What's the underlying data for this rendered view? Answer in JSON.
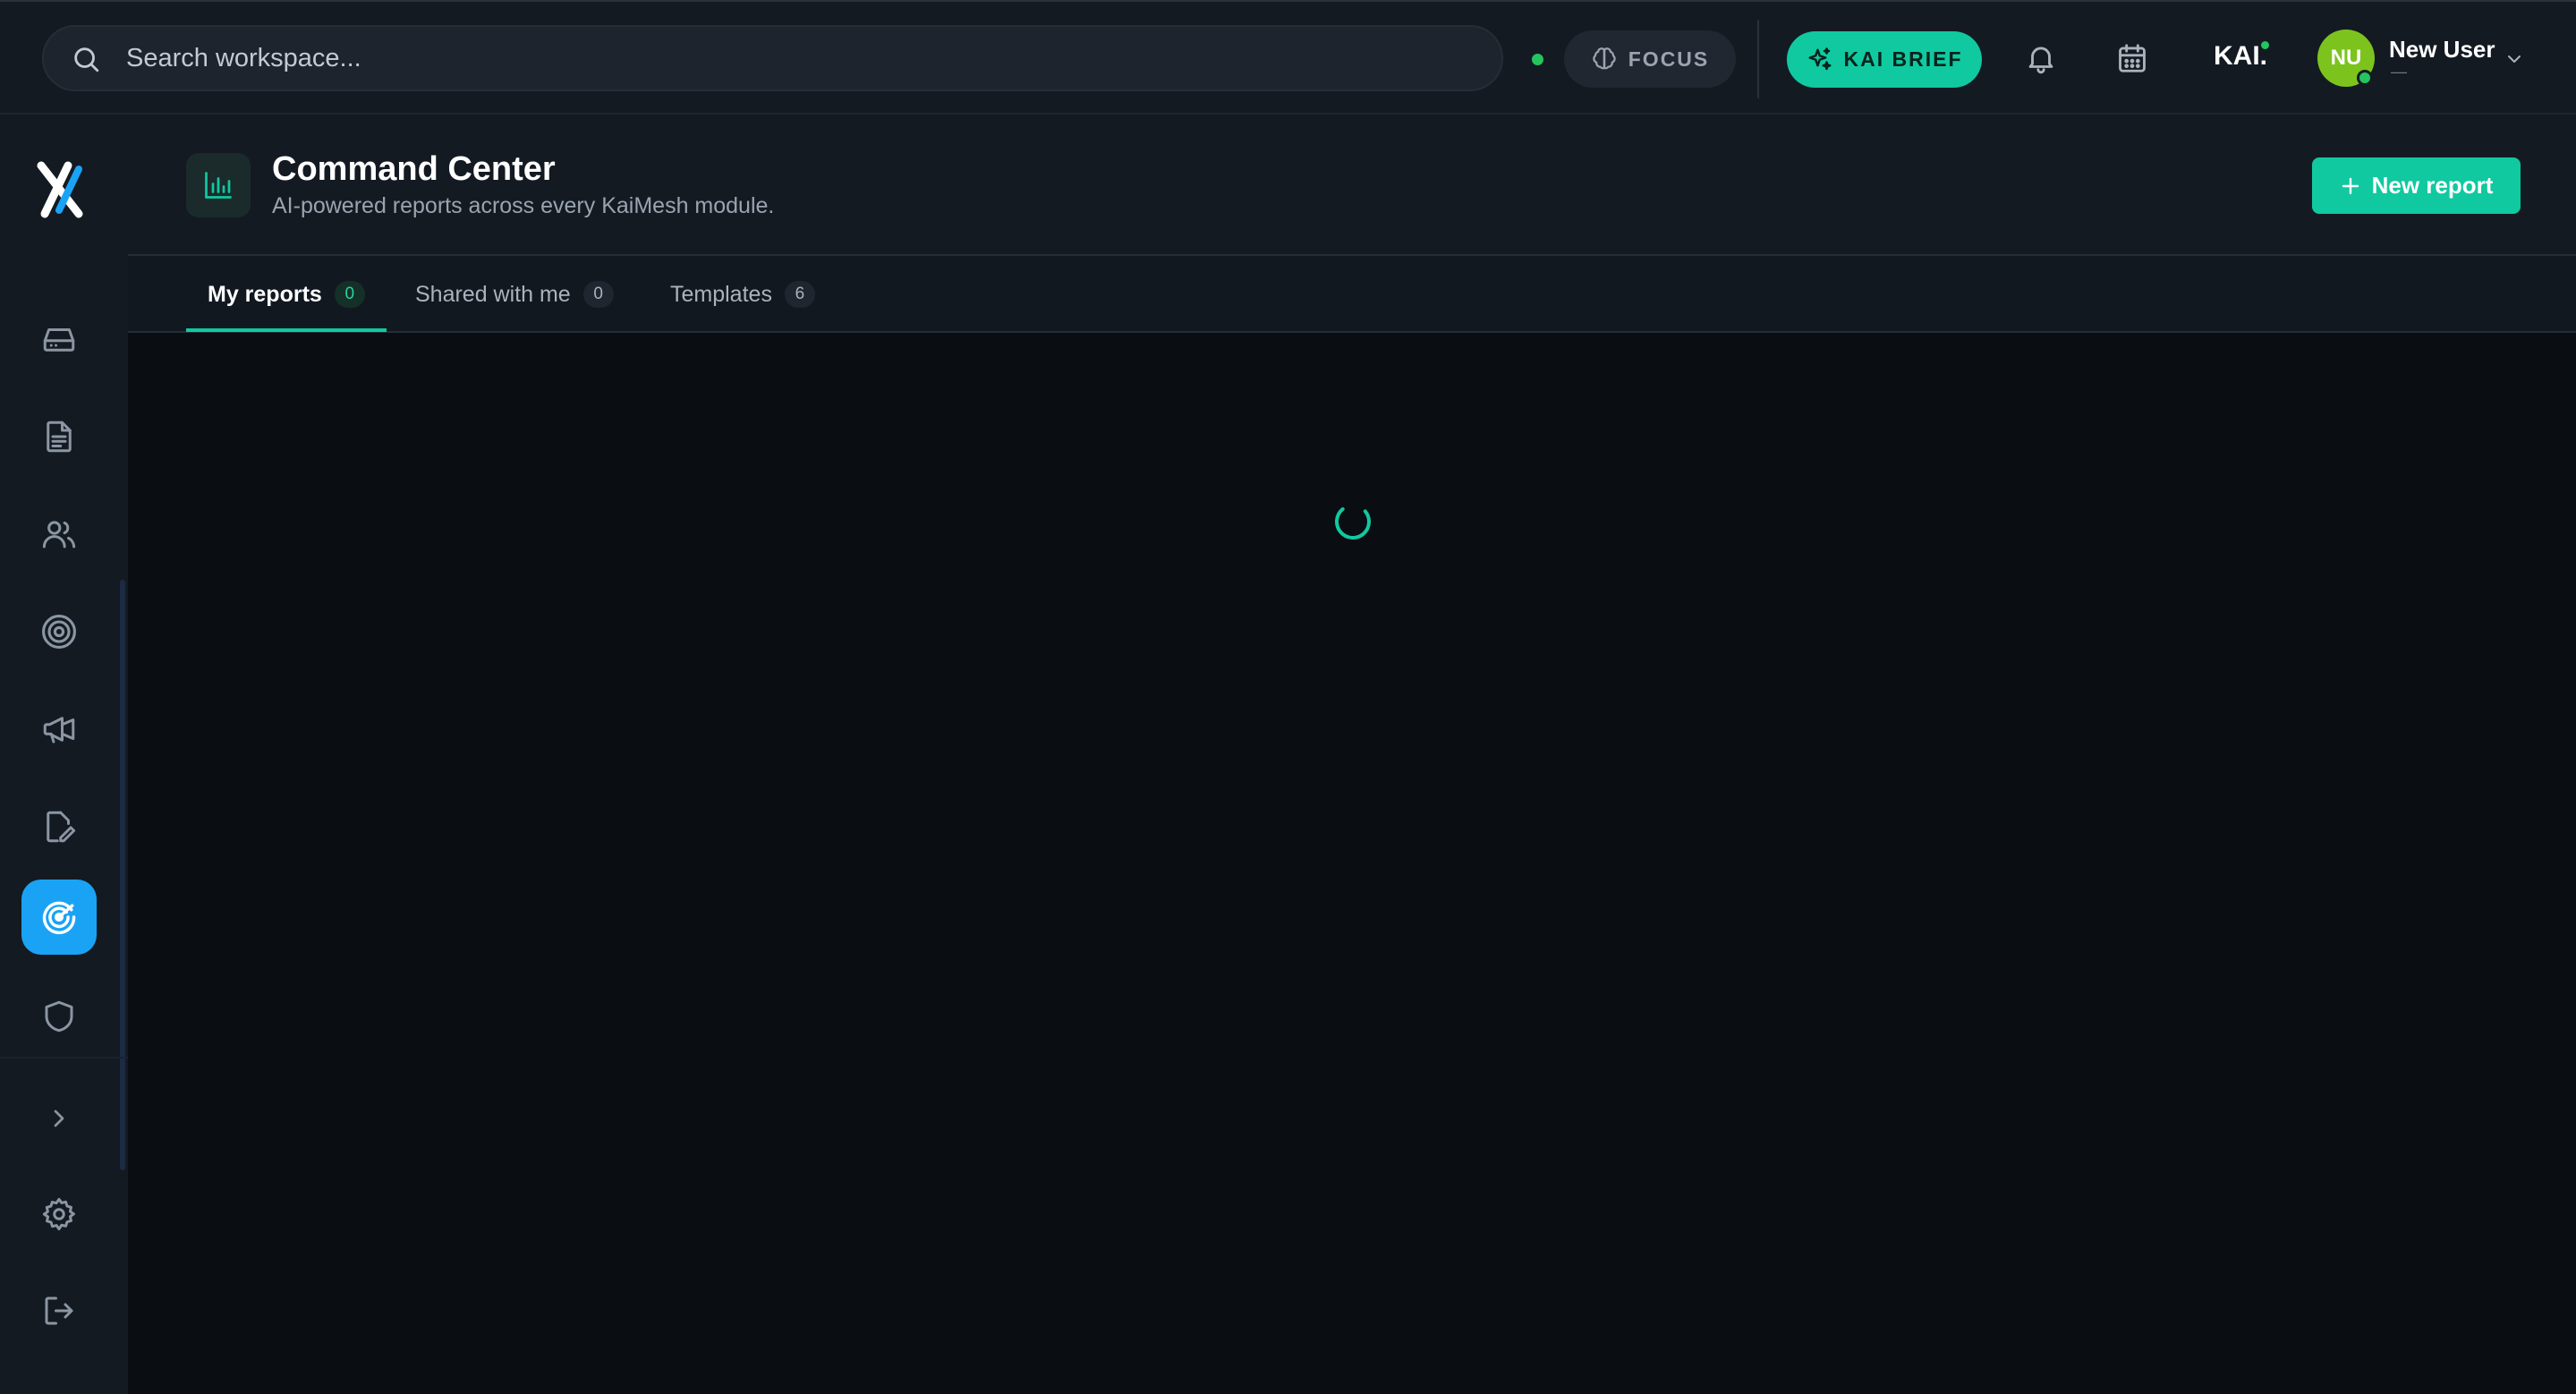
{
  "topbar": {
    "search_placeholder": "Search workspace...",
    "focus_label": "FOCUS",
    "kai_brief_label": "KAI BRIEF",
    "kai_logo": "KAI.",
    "user": {
      "initials": "NU",
      "name": "New User",
      "subtitle": "—"
    }
  },
  "page": {
    "title": "Command Center",
    "subtitle": "AI-powered reports across every KaiMesh module.",
    "new_report_label": "New report"
  },
  "tabs": [
    {
      "label": "My reports",
      "count": "0",
      "active": true
    },
    {
      "label": "Shared with me",
      "count": "0",
      "active": false
    },
    {
      "label": "Templates",
      "count": "6",
      "active": false
    }
  ],
  "sidebar": {
    "items": [
      {
        "icon": "inbox-icon"
      },
      {
        "icon": "document-icon"
      },
      {
        "icon": "users-icon"
      },
      {
        "icon": "target-icon"
      },
      {
        "icon": "megaphone-icon"
      },
      {
        "icon": "edit-document-icon"
      },
      {
        "icon": "radar-icon",
        "active": true
      },
      {
        "icon": "shield-icon"
      }
    ],
    "bottom": [
      "expand-chevron-icon",
      "settings-icon",
      "logout-icon"
    ]
  },
  "colors": {
    "accent": "#10c9a0",
    "active_nav": "#1aa3f5",
    "avatar": "#7cc41d",
    "online": "#22c55e"
  }
}
